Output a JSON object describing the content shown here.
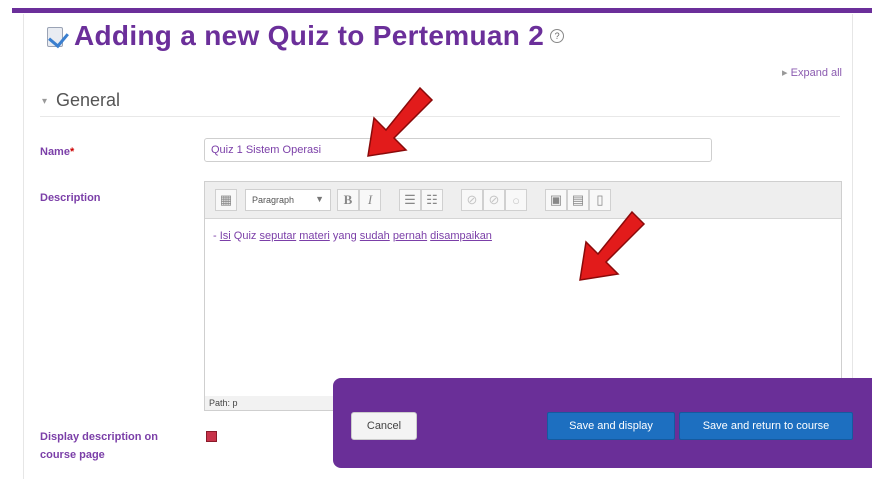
{
  "page": {
    "title": "Adding a new Quiz to Pertemuan 2",
    "expand_all": "Expand all"
  },
  "section": {
    "label": "General"
  },
  "form": {
    "name_label": "Name",
    "name_required_mark": "*",
    "name_value": "Quiz 1 Sistem Operasi",
    "description_label": "Description",
    "display_label": "Display description on course page"
  },
  "editor": {
    "paragraph_select": "Paragraph",
    "body_prefix": "- ",
    "body_words": [
      "Isi",
      "Quiz",
      "seputar",
      "materi",
      "yang",
      "sudah",
      "pernah",
      "disampaikan"
    ],
    "path": "Path: p",
    "toolbar_icons": [
      "toggle-toolbar-icon",
      "bold-icon",
      "italic-icon",
      "bullet-list-icon",
      "numbered-list-icon",
      "link-icon",
      "unlink-icon",
      "anchor-icon",
      "image-icon",
      "media-icon",
      "paste-icon"
    ]
  },
  "display_description_checked": true,
  "actions": {
    "cancel": "Cancel",
    "save_display": "Save and display",
    "save_return": "Save and return to course"
  },
  "colors": {
    "accent": "#6b2f9a",
    "action_bar": "#6a2f98",
    "button_blue": "#1d6fc0",
    "arrow_red": "#e21b1b"
  }
}
